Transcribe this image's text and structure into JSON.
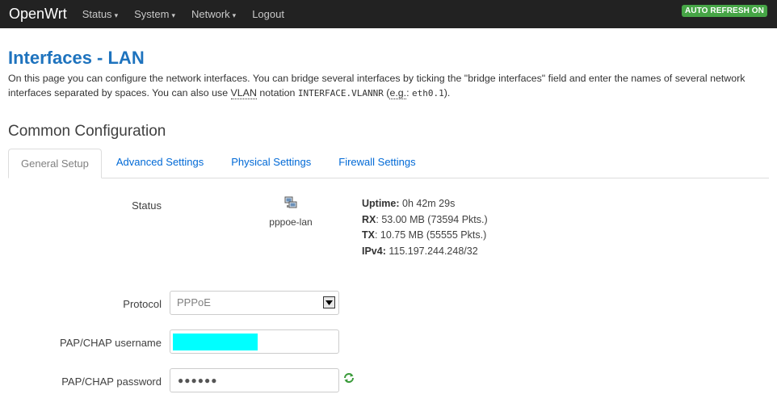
{
  "nav": {
    "brand": "OpenWrt",
    "menu": [
      {
        "label": "Status",
        "caret": "▾"
      },
      {
        "label": "System",
        "caret": "▾"
      },
      {
        "label": "Network",
        "caret": "▾"
      },
      {
        "label": "Logout",
        "caret": ""
      }
    ],
    "auto_refresh": "AUTO REFRESH ON"
  },
  "page": {
    "title": "Interfaces - LAN",
    "desc_part1": "On this page you can configure the network interfaces. You can bridge several interfaces by ticking the \"bridge interfaces\" field and enter the names of several network interfaces separated by spaces. You can also use ",
    "desc_vlan": "VLAN",
    "desc_part2": " notation ",
    "desc_code1": "INTERFACE.VLANNR",
    "desc_part3": " (",
    "desc_eg": "e.g.",
    "desc_part4": ": ",
    "desc_code2": "eth0.1",
    "desc_part5": ").",
    "section_title": "Common Configuration"
  },
  "tabs": [
    "General Setup",
    "Advanced Settings",
    "Physical Settings",
    "Firewall Settings"
  ],
  "status": {
    "label": "Status",
    "ifname": "pppoe-lan",
    "uptime_label": "Uptime:",
    "uptime_value": " 0h 42m 29s",
    "rx_label": "RX",
    "rx_value": ": 53.00 MB (73594 Pkts.)",
    "tx_label": "TX",
    "tx_value": ": 10.75 MB (55555 Pkts.)",
    "ipv4_label": "IPv4:",
    "ipv4_value": " 115.197.244.248/32"
  },
  "form": {
    "protocol_label": "Protocol",
    "protocol_value": "PPPoE",
    "username_label": "PAP/CHAP username",
    "password_label": "PAP/CHAP password",
    "password_value": "●●●●●●"
  },
  "colors": {
    "navbar": "#222222",
    "title": "#1e73be",
    "link": "#0069d6",
    "badge": "#46a546",
    "redaction": "#00ffff"
  }
}
